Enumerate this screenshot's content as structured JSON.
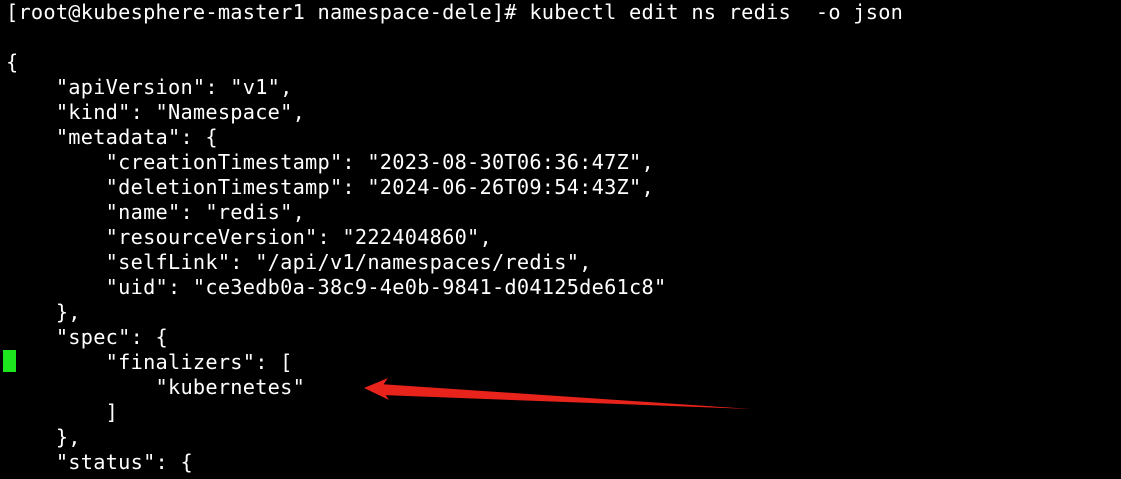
{
  "terminal": {
    "prompt": "[root@kubesphere-master1 namespace-dele]# kubectl edit ns redis  -o json",
    "lines": [
      "",
      "{",
      "    \"apiVersion\": \"v1\",",
      "    \"kind\": \"Namespace\",",
      "    \"metadata\": {",
      "        \"creationTimestamp\": \"2023-08-30T06:36:47Z\",",
      "        \"deletionTimestamp\": \"2024-06-26T09:54:43Z\",",
      "        \"name\": \"redis\",",
      "        \"resourceVersion\": \"222404860\",",
      "        \"selfLink\": \"/api/v1/namespaces/redis\",",
      "        \"uid\": \"ce3edb0a-38c9-4e0b-9841-d04125de61c8\"",
      "    },",
      "    \"spec\": {",
      "        \"finalizers\": [",
      "            \"kubernetes\"",
      "        ]",
      "    },",
      "    \"status\": {"
    ],
    "cursor_color": "#1ee61e",
    "text_color": "#ffffff",
    "background_color": "#000000"
  },
  "annotation": {
    "type": "arrow",
    "color": "#e8231b",
    "points_to": "kubernetes"
  }
}
